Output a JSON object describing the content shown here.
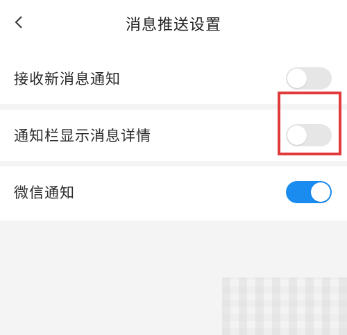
{
  "header": {
    "title": "消息推送设置",
    "back_icon": "chevron-left-icon"
  },
  "settings": [
    {
      "label": "接收新消息通知",
      "enabled": false
    },
    {
      "label": "通知栏显示消息详情",
      "enabled": false
    },
    {
      "label": "微信通知",
      "enabled": true
    }
  ],
  "colors": {
    "toggle_on": "#1a8cf0",
    "toggle_off": "#e6e6e6",
    "highlight": "#e03a3a",
    "background": "#f4f4f4"
  }
}
